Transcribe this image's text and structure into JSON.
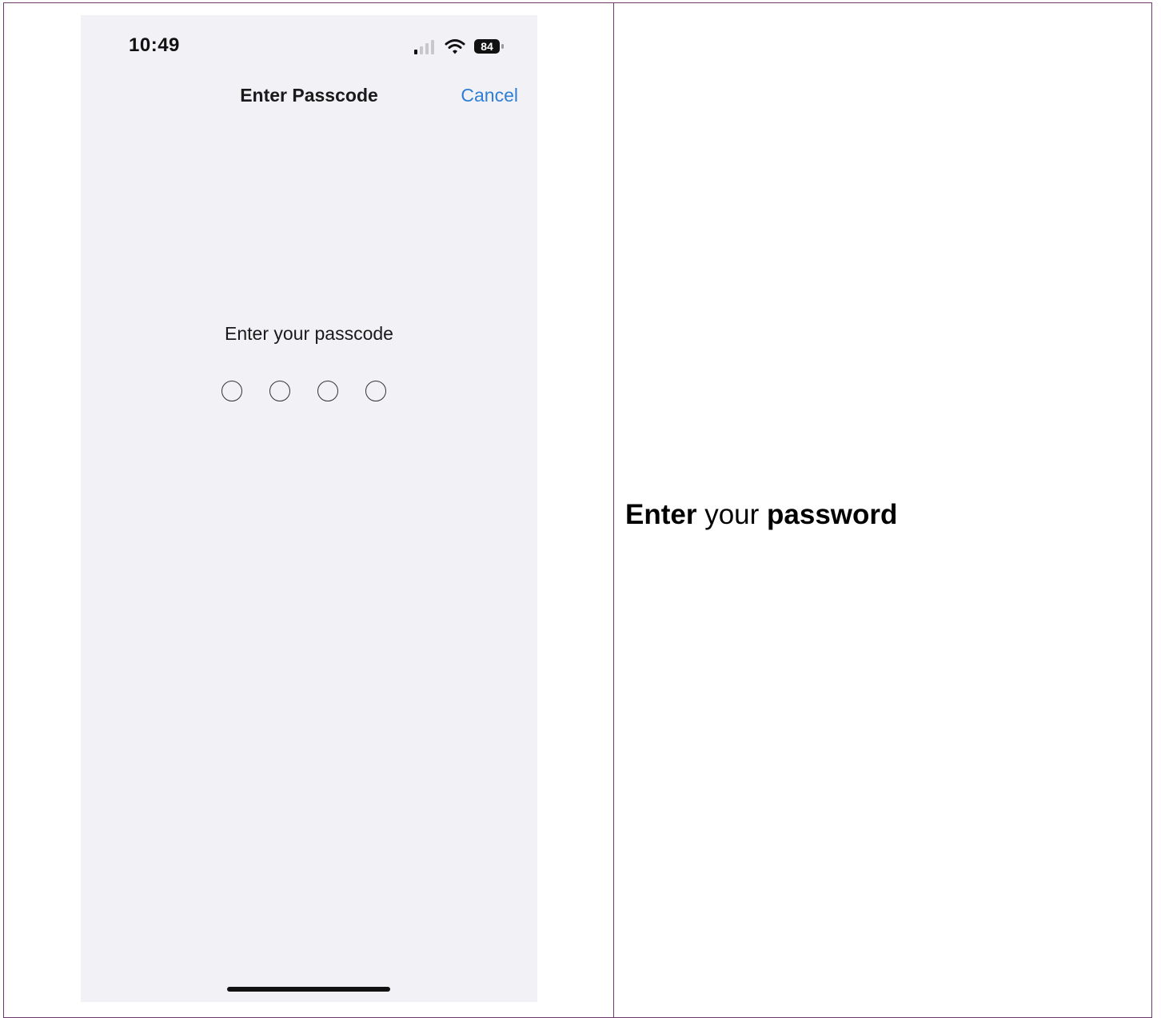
{
  "phone": {
    "status_bar": {
      "time": "10:49",
      "battery_level": "84"
    },
    "nav": {
      "title": "Enter Passcode",
      "cancel_label": "Cancel"
    },
    "prompt": "Enter your passcode",
    "passcode_length": 4,
    "accent_color": "#2f7fd4",
    "background_color": "#f1f1f6"
  },
  "instruction": {
    "word1": "Enter",
    "word2": "your",
    "word3": "password"
  }
}
